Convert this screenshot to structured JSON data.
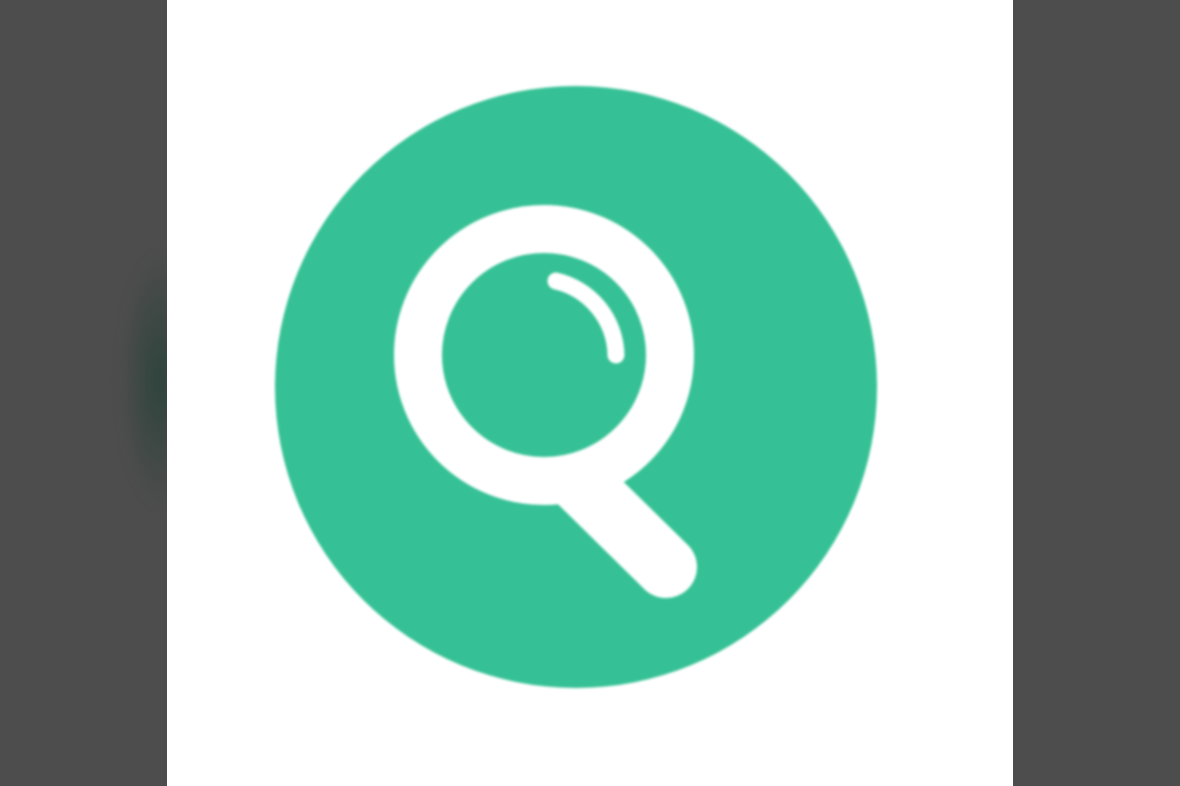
{
  "viewer": {
    "background_color": "#4d4d4d",
    "panel_color": "#ffffff"
  },
  "icon": {
    "name": "search-icon",
    "circle_color": "#35c195",
    "glyph_color": "#ffffff"
  }
}
